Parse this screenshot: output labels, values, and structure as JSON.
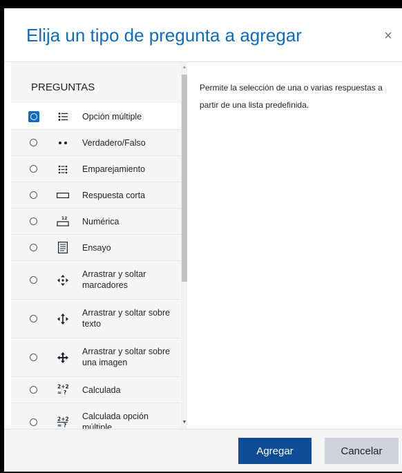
{
  "dialog": {
    "title": "Elija un tipo de pregunta a agregar",
    "close_symbol": "×"
  },
  "list": {
    "header": "PREGUNTAS",
    "items": [
      {
        "label": "Opción múltiple",
        "icon": "multichoice-icon",
        "selected": true
      },
      {
        "label": "Verdadero/Falso",
        "icon": "truefalse-icon",
        "selected": false
      },
      {
        "label": "Emparejamiento",
        "icon": "match-icon",
        "selected": false
      },
      {
        "label": "Respuesta corta",
        "icon": "shortanswer-icon",
        "selected": false
      },
      {
        "label": "Numérica",
        "icon": "numerical-icon",
        "selected": false
      },
      {
        "label": "Ensayo",
        "icon": "essay-icon",
        "selected": false
      },
      {
        "label": "Arrastrar y soltar marcadores",
        "icon": "ddmarker-icon",
        "selected": false
      },
      {
        "label": "Arrastrar y soltar sobre texto",
        "icon": "ddwtos-icon",
        "selected": false
      },
      {
        "label": "Arrastrar y soltar sobre una imagen",
        "icon": "ddimageortext-icon",
        "selected": false
      },
      {
        "label": "Calculada",
        "icon": "calculated-icon",
        "selected": false
      },
      {
        "label": "Calculada opción múltiple",
        "icon": "calculatedmulti-icon",
        "selected": false
      }
    ]
  },
  "description": "Permite la selección de una o varias respuestas a partir de una lista predefinida.",
  "footer": {
    "add_label": "Agregar",
    "cancel_label": "Cancelar"
  },
  "colors": {
    "title": "#0f6cbf",
    "primary_button": "#0f4c98",
    "secondary_button": "#ced4da",
    "selected_radio": "#0f6cbf"
  }
}
